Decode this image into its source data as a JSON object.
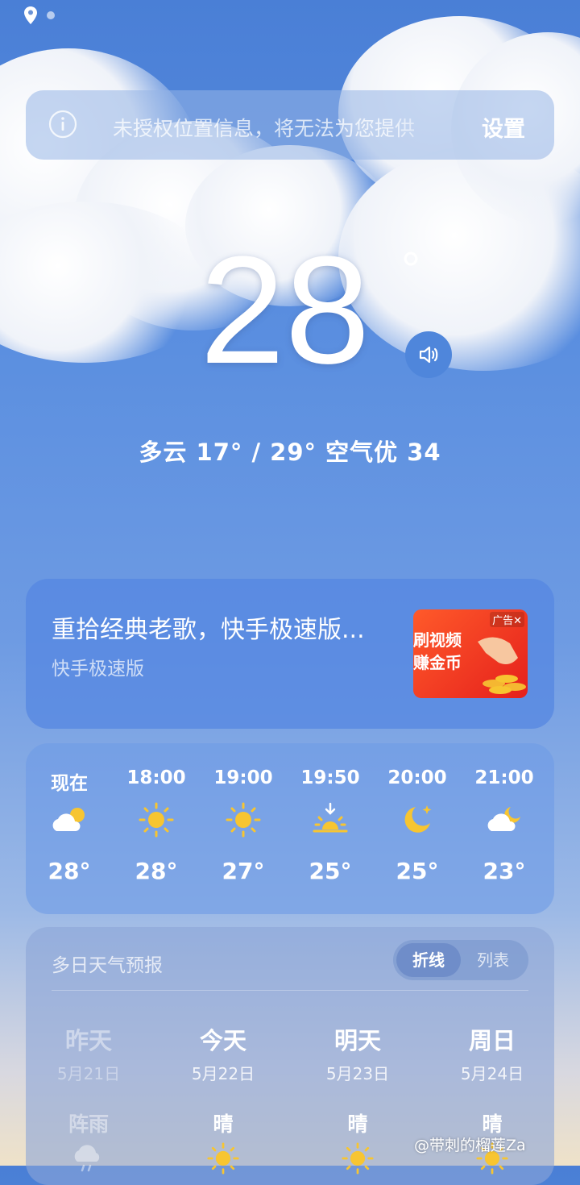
{
  "location_banner": {
    "message": "未授权位置信息，将无法为您提供",
    "settings_label": "设置"
  },
  "current": {
    "temperature": "28",
    "degree_symbol": "°",
    "summary": "多云  17° / 29°  空气优 34"
  },
  "ad": {
    "title": "重拾经典老歌，快手极速版...",
    "source": "快手极速版",
    "image_text_line1": "刷视频",
    "image_text_line2": "赚金币",
    "tag": "广告✕"
  },
  "hourly": [
    {
      "time": "现在",
      "icon": "partly-cloudy-icon",
      "temp": "28°"
    },
    {
      "time": "18:00",
      "icon": "sun-icon",
      "temp": "28°"
    },
    {
      "time": "19:00",
      "icon": "sun-icon",
      "temp": "27°"
    },
    {
      "time": "19:50",
      "icon": "sunset-icon",
      "temp": "25°"
    },
    {
      "time": "20:00",
      "icon": "moon-icon",
      "temp": "25°"
    },
    {
      "time": "21:00",
      "icon": "cloudy-night-icon",
      "temp": "23°"
    }
  ],
  "forecast": {
    "title": "多日天气预报",
    "toggle_line": "折线",
    "toggle_list": "列表",
    "days": [
      {
        "name": "昨天",
        "date": "5月21日",
        "cond": "阵雨",
        "icon": "rain-icon"
      },
      {
        "name": "今天",
        "date": "5月22日",
        "cond": "晴",
        "icon": "sun-icon"
      },
      {
        "name": "明天",
        "date": "5月23日",
        "cond": "晴",
        "icon": "sun-icon"
      },
      {
        "name": "周日",
        "date": "5月24日",
        "cond": "晴",
        "icon": "sun-icon"
      }
    ]
  },
  "watermark": "@带刺的榴莲Za",
  "colors": {
    "sky_top": "#4a7fd6",
    "sun_yellow": "#f7c531",
    "ad_red": "#e5201c"
  }
}
